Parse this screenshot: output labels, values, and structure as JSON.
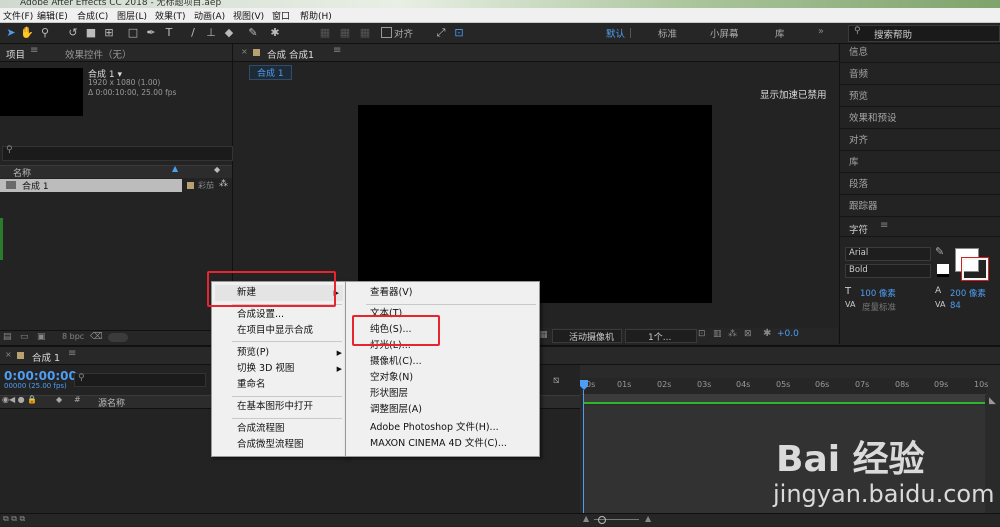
{
  "window": {
    "title": "Adobe After Effects CC 2018 - 无标题项目.aep"
  },
  "menu": [
    "文件(F)",
    "编辑(E)",
    "合成(C)",
    "图层(L)",
    "效果(T)",
    "动画(A)",
    "视图(V)",
    "窗口",
    "帮助(H)"
  ],
  "toolbar": {
    "snap_label": "对齐",
    "workspaces": [
      "默认",
      "标准",
      "小屏幕",
      "库"
    ],
    "search_placeholder": "搜索帮助"
  },
  "project": {
    "tab_project": "项目",
    "tab_effects": "效果控件（无）",
    "comp_name": "合成 1 ▾",
    "comp_info1": "1920 x 1080 (1.00)",
    "comp_info2": "Δ 0:00:10:00, 25.00 fps",
    "col_name": "名称",
    "item_name": "合成 1",
    "item_label": "彩茄",
    "bpc": "8 bpc"
  },
  "comp_panel": {
    "tab": "合成 合成1",
    "sub_tab": "合成 1",
    "accel_notice": "显示加速已禁用",
    "camera": "活动摄像机",
    "views": "1个...",
    "exposure": "+0.0"
  },
  "timeline": {
    "tab": "合成 1",
    "timecode": "0:00:00:00",
    "fps_note": "00000 (25.00 fps)",
    "col_source": "源名称",
    "ticks": [
      "0s",
      "01s",
      "02s",
      "03s",
      "04s",
      "05s",
      "06s",
      "07s",
      "08s",
      "09s",
      "10s"
    ]
  },
  "right_panel": {
    "items": [
      "信息",
      "音频",
      "预览",
      "效果和预设",
      "对齐",
      "库",
      "段落",
      "跟踪器"
    ],
    "char_title": "字符",
    "font": "Arial",
    "style": "Bold",
    "size": "100 像素",
    "leading": "200 像素",
    "kerning": "度量标准",
    "tracking": "84"
  },
  "context_menu_main": [
    "新建",
    "合成设置...",
    "在项目中显示合成",
    "预览(P)",
    "切换 3D 视图",
    "重命名",
    "在基本图形中打开",
    "合成流程图",
    "合成微型流程图"
  ],
  "context_menu_sub": [
    "查看器(V)",
    "文本(T)",
    "纯色(S)...",
    "灯光(L)...",
    "摄像机(C)...",
    "空对象(N)",
    "形状图层",
    "调整图层(A)",
    "Adobe Photoshop 文件(H)...",
    "MAXON CINEMA 4D 文件(C)..."
  ],
  "watermark": {
    "brand": "Bai 经验",
    "url": "jingyan.baidu.com"
  },
  "colors": {
    "accent": "#4f9df2",
    "highlight": "#e8252f",
    "work_area": "#2eb82e"
  }
}
